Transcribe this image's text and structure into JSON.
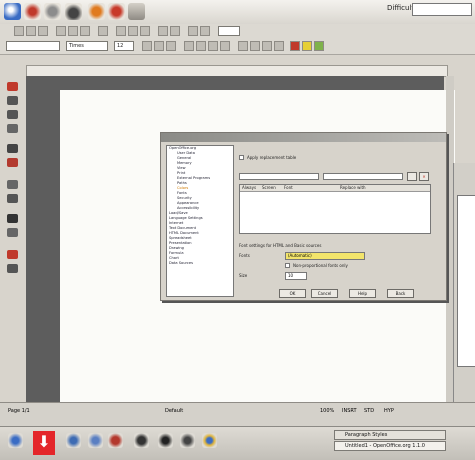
{
  "topbar": {
    "difficulty_label": "Difficulty",
    "difficulty_value": ""
  },
  "toolbar": {
    "style_combo": "",
    "font_combo": "Times",
    "size_combo": "12",
    "zoom_combo": ""
  },
  "dialog": {
    "title": "",
    "tree": [
      "OpenOffice.org",
      "User Data",
      "General",
      "Memory",
      "View",
      "Print",
      "External Programs",
      "Paths",
      "Colors",
      "Fonts",
      "Security",
      "Appearance",
      "Accessibility",
      "Load/Save",
      "Language Settings",
      "Internet",
      "Text Document",
      "HTML Document",
      "Spreadsheet",
      "Presentation",
      "Drawing",
      "Formula",
      "Chart",
      "Data Sources"
    ],
    "apply_label": "Apply replacement table",
    "col_headers": [
      "Font",
      "Replace with",
      "Always",
      "Screen"
    ],
    "section_label": "Font settings for HTML and Basic sources",
    "fonts_label": "Fonts",
    "fonts_value": "(Automatic)",
    "proportional_label": "Non-proportional fonts only",
    "size_label": "Size",
    "size_value": "10",
    "ok": "OK",
    "cancel": "Cancel",
    "help": "Help",
    "back": "Back",
    "accent": "#f2e46b"
  },
  "status": {
    "page": "Page 1/1",
    "style": "Default",
    "zoom": "100%",
    "mode": "INSRT",
    "std": "STD",
    "hyp": "HYP"
  },
  "taskbar": {
    "tasks": [
      "Paragraph Styles",
      "Untitled1 - OpenOffice.org 1.1.0"
    ],
    "accent": "#e4262a"
  }
}
